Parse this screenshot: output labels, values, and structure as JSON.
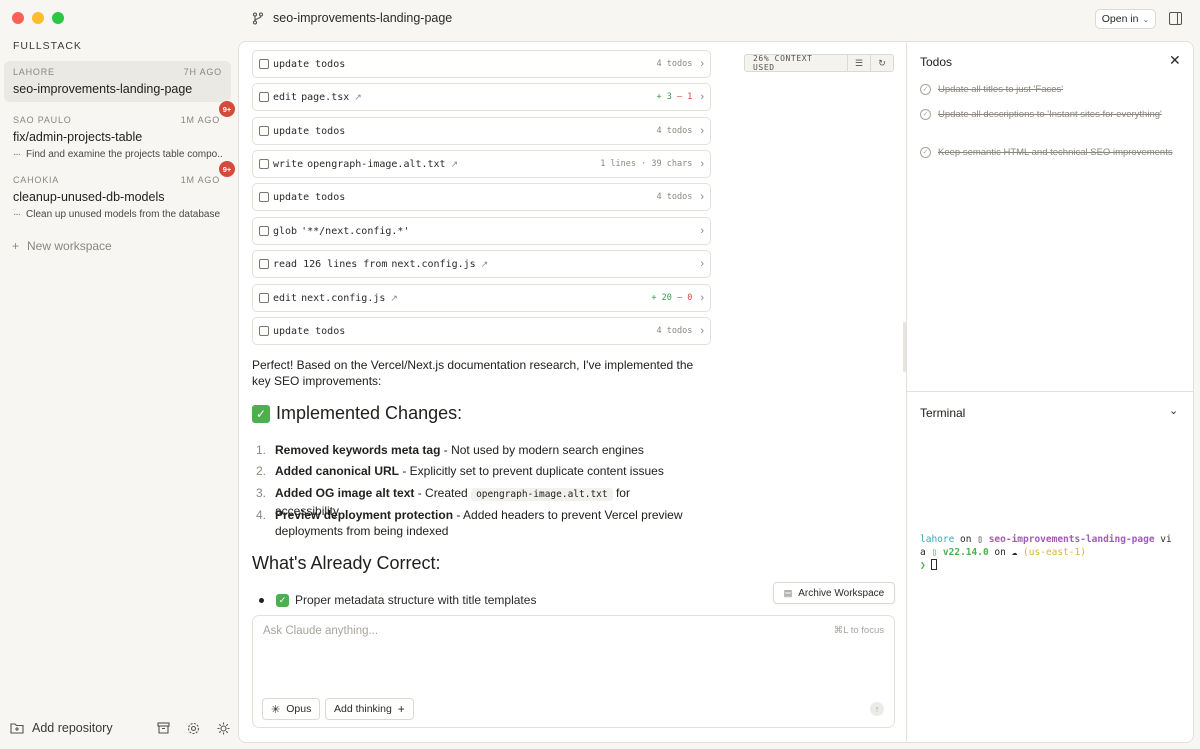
{
  "sidebar": {
    "section_title": "FULLSTACK",
    "workspaces": [
      {
        "location": "LAHORE",
        "age": "7H AGO",
        "name": "seo-improvements-landing-page",
        "subtitle": "",
        "badge": ""
      },
      {
        "location": "SAO PAULO",
        "age": "1M AGO",
        "name": "fix/admin-projects-table",
        "subtitle": "Find and examine the projects table compo...",
        "badge": "9+"
      },
      {
        "location": "CAHOKIA",
        "age": "1M AGO",
        "name": "cleanup-unused-db-models",
        "subtitle": "Clean up unused models from the database",
        "badge": "9+"
      }
    ],
    "new_workspace": "New workspace",
    "add_repository": "Add repository"
  },
  "header": {
    "branch": "seo-improvements-landing-page",
    "open_in": "Open in"
  },
  "context": {
    "label": "26% CONTEXT USED"
  },
  "tools": [
    {
      "verb": "update todos",
      "arg": "",
      "meta": "4 todos",
      "ext": false,
      "icon": "checkbox-icon"
    },
    {
      "verb": "edit",
      "arg": "page.tsx",
      "meta_plus": "+ 3",
      "meta_minus": "— 1",
      "ext": true,
      "icon": "edit-icon"
    },
    {
      "verb": "update todos",
      "arg": "",
      "meta": "4 todos",
      "ext": false,
      "icon": "checkbox-icon"
    },
    {
      "verb": "write",
      "arg": "opengraph-image.alt.txt",
      "meta": "1 lines · 39 chars",
      "ext": true,
      "icon": "file-icon"
    },
    {
      "verb": "update todos",
      "arg": "",
      "meta": "4 todos",
      "ext": false,
      "icon": "checkbox-icon"
    },
    {
      "verb": "glob",
      "arg": "'**/next.config.*'",
      "meta": "",
      "ext": false,
      "icon": "file-icon"
    },
    {
      "verb": "read 126 lines from",
      "arg": "next.config.js",
      "meta": "",
      "ext": true,
      "icon": "file-icon"
    },
    {
      "verb": "edit",
      "arg": "next.config.js",
      "meta_plus": "+ 20",
      "meta_minus": "— 0",
      "ext": true,
      "icon": "edit-icon"
    },
    {
      "verb": "update todos",
      "arg": "",
      "meta": "4 todos",
      "ext": false,
      "icon": "checkbox-icon"
    }
  ],
  "message": {
    "intro": "Perfect! Based on the Vercel/Next.js documentation research, I've implemented the key SEO improvements:",
    "heading1": "Implemented Changes:",
    "changes": [
      {
        "num": "1.",
        "bold": "Removed keywords meta tag",
        "rest": " - Not used by modern search engines"
      },
      {
        "num": "2.",
        "bold": "Added canonical URL",
        "rest": " - Explicitly set to prevent duplicate content issues"
      },
      {
        "num": "3.",
        "bold": "Added OG image alt text",
        "rest_before": " - Created ",
        "code": "opengraph-image.alt.txt",
        "rest_after": " for accessibility"
      },
      {
        "num": "4.",
        "bold": "Preview deployment protection",
        "rest": " - Added headers to prevent Vercel preview deployments from being indexed"
      }
    ],
    "heading2": "What's Already Correct:",
    "correct": [
      "Proper metadata structure with title templates"
    ]
  },
  "archive_button": "Archive Workspace",
  "composer": {
    "placeholder": "Ask Claude anything...",
    "hint": "⌘L to focus",
    "model": "Opus",
    "thinking": "Add thinking"
  },
  "todos": {
    "title": "Todos",
    "items": [
      "Update all titles to just 'Faces'",
      "Update all descriptions to 'Instant sites for everything'",
      "Keep semantic HTML and technical SEO improvements"
    ]
  },
  "terminal": {
    "title": "Terminal",
    "user": "lahore",
    "on1": " on ",
    "branch": "seo-improvements-landing-page",
    "via": " vi",
    "line2_a": "a ",
    "node": "v22.14.0",
    "on2": " on ",
    "region": "(us-east-1)",
    "prompt": "❯"
  },
  "colors": {
    "badge": "#d44b3b",
    "accent_green": "#4caf50",
    "diff_add": "#3a9a4a",
    "diff_remove": "#d44b3b"
  }
}
